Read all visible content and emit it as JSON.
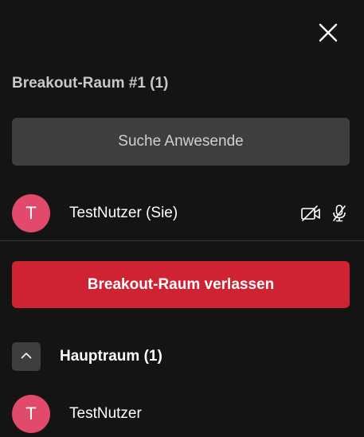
{
  "panel": {
    "breakout_title": "Breakout-Raum #1 (1)",
    "search_placeholder": "Suche Anwesende",
    "leave_button_label": "Breakout-Raum verlassen",
    "main_room_title": "Hauptraum (1)"
  },
  "breakout_participants": [
    {
      "initial": "T",
      "name": "TestNutzer (Sie)",
      "camera_icon": "camera-off-icon",
      "mic_icon": "mic-off-icon"
    }
  ],
  "main_room_participants": [
    {
      "initial": "T",
      "name": "TestNutzer"
    }
  ],
  "icons": {
    "close": "close-icon",
    "collapse": "chevron-up-icon"
  },
  "colors": {
    "background": "#141414",
    "avatar": "#e24a6c",
    "leave_button": "#cf2334",
    "search_field": "#3e3e3e"
  }
}
